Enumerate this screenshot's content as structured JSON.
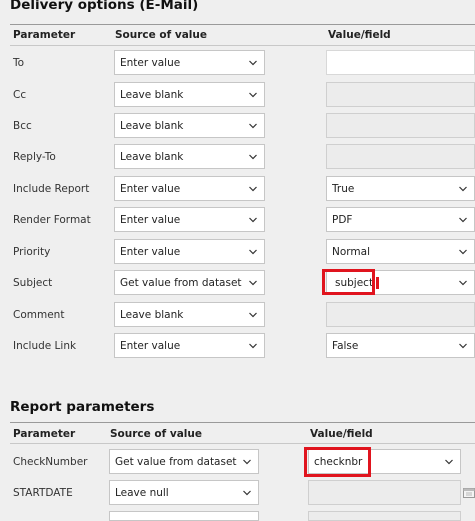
{
  "delivery": {
    "title": "Delivery options (E-Mail)",
    "headers": {
      "parameter": "Parameter",
      "source": "Source of value",
      "value": "Value/field"
    },
    "rows": [
      {
        "label": "To",
        "source": "Enter value",
        "value_type": "textbox",
        "value": ""
      },
      {
        "label": "Cc",
        "source": "Leave blank",
        "value_type": "disabled",
        "value": ""
      },
      {
        "label": "Bcc",
        "source": "Leave blank",
        "value_type": "disabled",
        "value": ""
      },
      {
        "label": "Reply-To",
        "source": "Leave blank",
        "value_type": "disabled",
        "value": ""
      },
      {
        "label": "Include Report",
        "source": "Enter value",
        "value_type": "select",
        "value": "True"
      },
      {
        "label": "Render Format",
        "source": "Enter value",
        "value_type": "select",
        "value": "PDF"
      },
      {
        "label": "Priority",
        "source": "Enter value",
        "value_type": "select",
        "value": "Normal"
      },
      {
        "label": "Subject",
        "source": "Get value from dataset",
        "value_type": "select",
        "value": "subject",
        "highlighted": true
      },
      {
        "label": "Comment",
        "source": "Leave blank",
        "value_type": "disabled",
        "value": ""
      },
      {
        "label": "Include Link",
        "source": "Enter value",
        "value_type": "select",
        "value": "False"
      }
    ]
  },
  "report_params": {
    "title": "Report parameters",
    "headers": {
      "parameter": "Parameter",
      "source": "Source of value",
      "value": "Value/field"
    },
    "rows": [
      {
        "label": "CheckNumber",
        "source": "Get value from dataset",
        "value_type": "select",
        "value": "checknbr",
        "highlighted": true
      },
      {
        "label": "STARTDATE",
        "source": "Leave null",
        "value_type": "date-disabled",
        "value": ""
      }
    ]
  },
  "icons": {
    "dropdown": "chevron-down-icon",
    "date": "calendar-icon"
  },
  "colors": {
    "highlight": "#e0141e",
    "background": "#efefef"
  }
}
